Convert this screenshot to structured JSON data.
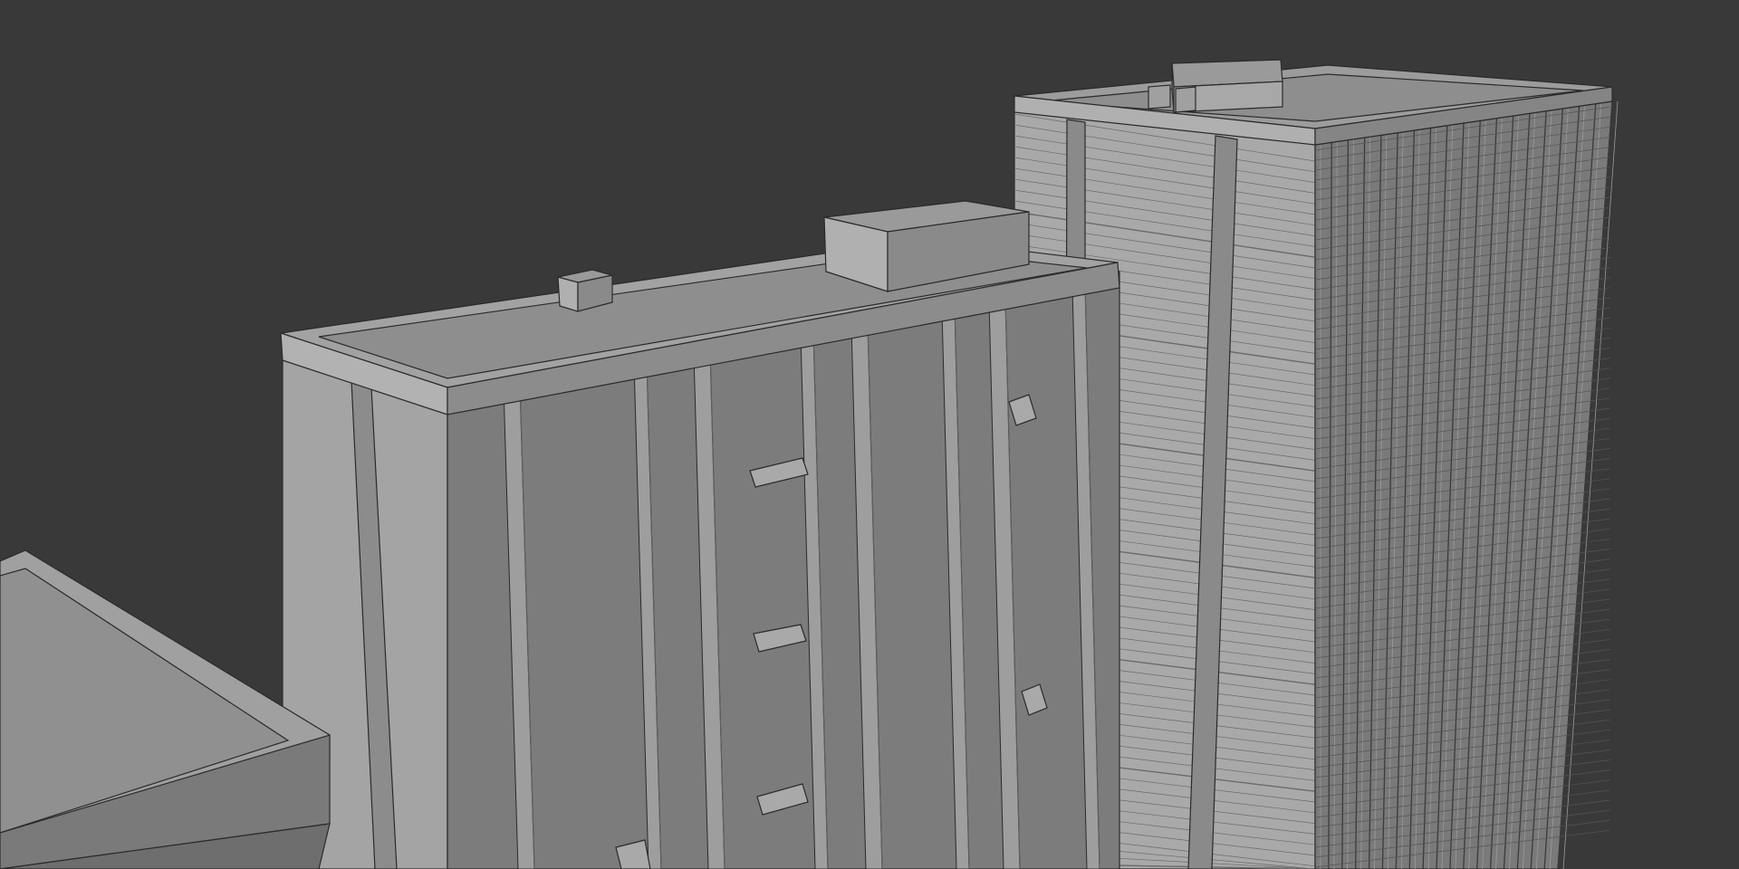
{
  "viewport": {
    "background": "#393939",
    "render_mode": "solid-gray-clay",
    "shading": {
      "roof": "#8f8f8f",
      "front_face": "#7e7e7e",
      "lit_side_face": "#a6a6a6",
      "dark_side_face": "#707070",
      "edge_line": "#2a2a2a"
    }
  },
  "objects": [
    {
      "name": "low-building-left",
      "parts": [
        "roof",
        "parapet"
      ]
    },
    {
      "name": "mid-building",
      "parts": [
        "roof",
        "parapet",
        "rooftop-box-large",
        "rooftop-box-small",
        "vertical-fins",
        "wall-vents"
      ]
    },
    {
      "name": "tall-tower",
      "parts": [
        "roof",
        "parapet",
        "rooftop-units",
        "stacked-floor-bands",
        "window-grid-facade"
      ]
    }
  ]
}
